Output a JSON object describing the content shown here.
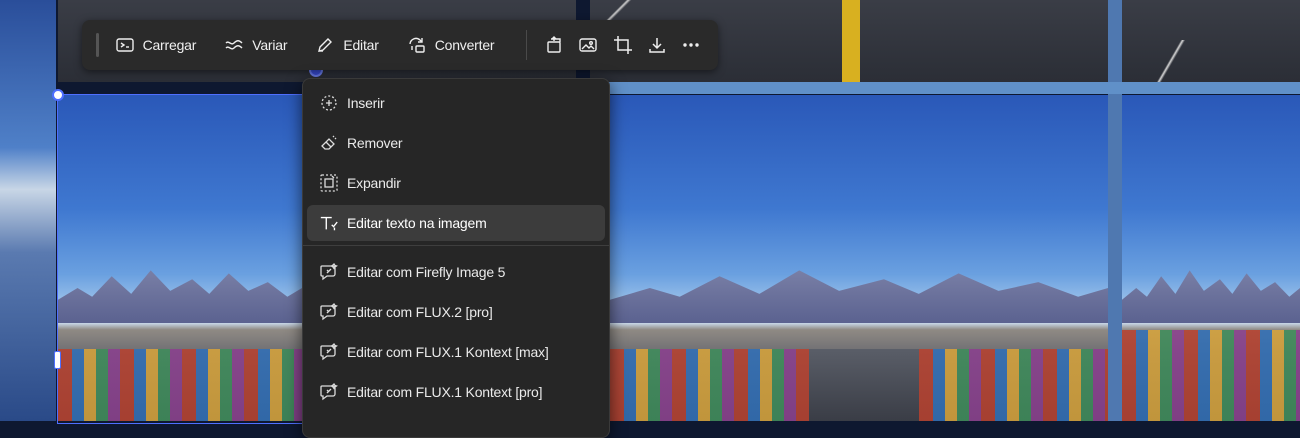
{
  "toolbar": {
    "items": [
      {
        "label": "Carregar",
        "icon": "upload-frame-icon"
      },
      {
        "label": "Variar",
        "icon": "wave-icon"
      },
      {
        "label": "Editar",
        "icon": "pencil-icon"
      },
      {
        "label": "Converter",
        "icon": "convert-icon"
      }
    ],
    "icons": [
      "bring-forward-icon",
      "image-icon",
      "crop-icon",
      "download-icon",
      "more-icon"
    ]
  },
  "menu": {
    "group1": [
      {
        "label": "Inserir",
        "icon": "insert-icon"
      },
      {
        "label": "Remover",
        "icon": "eraser-icon"
      },
      {
        "label": "Expandir",
        "icon": "expand-icon"
      },
      {
        "label": "Editar texto na imagem",
        "icon": "text-edit-icon"
      }
    ],
    "group2": [
      {
        "label": "Editar com Firefly Image 5",
        "icon": "ai-edit-icon"
      },
      {
        "label": "Editar com FLUX.2 [pro]",
        "icon": "ai-edit-icon"
      },
      {
        "label": "Editar com FLUX.1 Kontext [max]",
        "icon": "ai-edit-icon"
      },
      {
        "label": "Editar com FLUX.1 Kontext [pro]",
        "icon": "ai-edit-icon"
      }
    ]
  },
  "colors": {
    "accent": "#4f6fff",
    "panel": "#262626",
    "toolbar": "#2a2a2a"
  }
}
